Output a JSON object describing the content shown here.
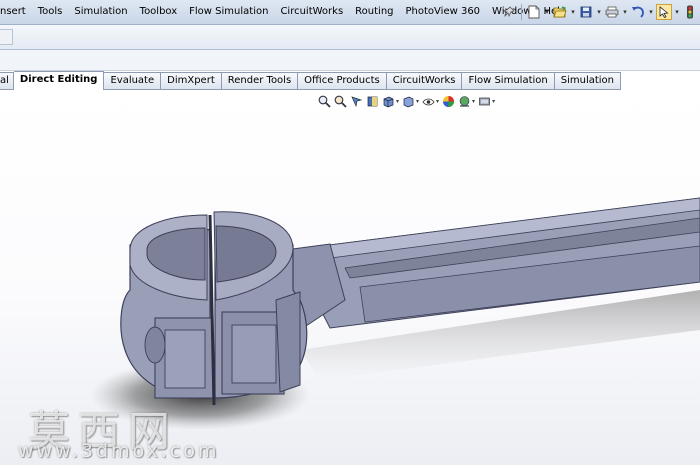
{
  "menu": {
    "items": [
      "nsert",
      "Tools",
      "Simulation",
      "Toolbox",
      "Flow Simulation",
      "CircuitWorks",
      "Routing",
      "PhotoView 360",
      "Window",
      "Help"
    ]
  },
  "toolbar": {
    "icons": [
      "pin-icon",
      "new-document-icon",
      "open-icon",
      "save-icon",
      "print-icon",
      "undo-icon",
      "select-icon",
      "traffic-light-icon"
    ]
  },
  "tabs": [
    {
      "label": "al"
    },
    {
      "label": "Direct Editing",
      "active": true
    },
    {
      "label": "Evaluate"
    },
    {
      "label": "DimXpert"
    },
    {
      "label": "Render Tools"
    },
    {
      "label": "Office Products"
    },
    {
      "label": "CircuitWorks"
    },
    {
      "label": "Flow Simulation"
    },
    {
      "label": "Simulation"
    }
  ],
  "view_tools": [
    "zoom-to-fit-icon",
    "zoom-area-icon",
    "previous-view-icon",
    "section-view-icon",
    "view-orientation-icon",
    "display-style-icon",
    "hide-show-icon",
    "edit-appearance-icon",
    "apply-scene-icon",
    "view-settings-icon"
  ],
  "model": {
    "part_color": "#9a9fb8",
    "part_shadow_color": "#6e7390"
  },
  "watermark": {
    "text_cn": "莫西网",
    "url": "www.3dmox.com"
  }
}
